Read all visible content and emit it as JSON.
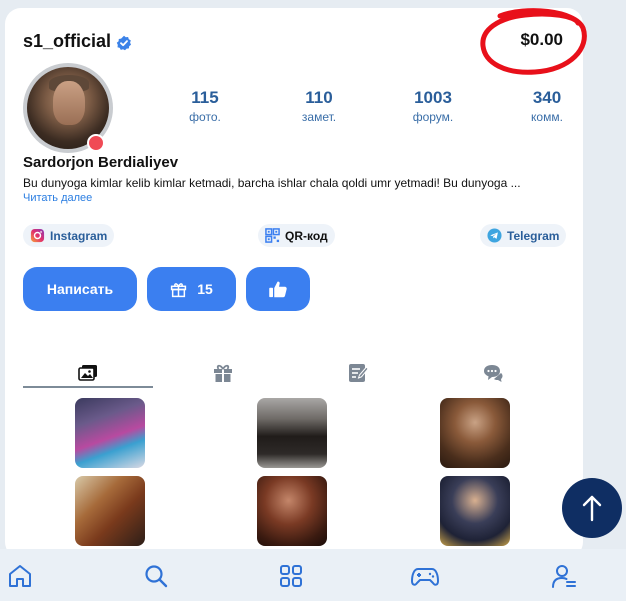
{
  "profile": {
    "username": "s1_official",
    "balance": "$0.00",
    "full_name": "Sardorjon Berdialiyev",
    "bio": "Bu dunyoga kimlar kelib kimlar ketmadi, barcha ishlar chala qoldi umr yetmadi! Bu dunyoga ...",
    "read_more": "Читать далее",
    "online_status": "online"
  },
  "stats": [
    {
      "value": "115",
      "label": "фото."
    },
    {
      "value": "110",
      "label": "замет."
    },
    {
      "value": "1003",
      "label": "форум."
    },
    {
      "value": "340",
      "label": "комм."
    }
  ],
  "links": {
    "instagram": "Instagram",
    "qr": "QR-код",
    "telegram": "Telegram"
  },
  "actions": {
    "write": "Написать",
    "gifts_count": "15"
  },
  "tabs": [
    {
      "icon": "photos-icon",
      "active": true
    },
    {
      "icon": "gift-icon",
      "active": false
    },
    {
      "icon": "notes-icon",
      "active": false
    },
    {
      "icon": "comments-icon",
      "active": false
    }
  ],
  "bottom_nav": [
    "home-icon",
    "search-icon",
    "apps-icon",
    "gamepad-icon",
    "profile-icon"
  ],
  "colors": {
    "accent": "#3b7ff0",
    "stat_text": "#2a5e9a",
    "fab": "#0f2e63",
    "online": "#f04a55",
    "annotation": "#e8101a"
  }
}
